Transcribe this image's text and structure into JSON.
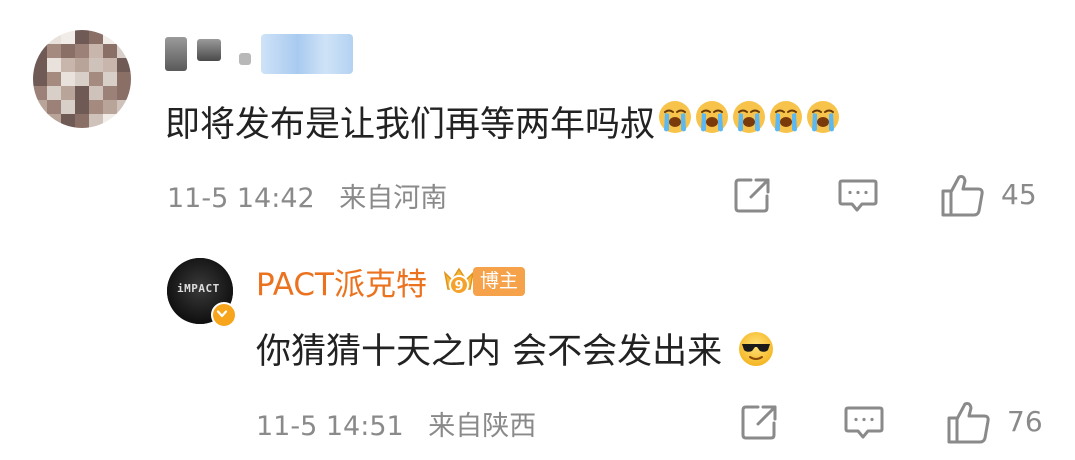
{
  "comment": {
    "text": "即将发布是让我们再等两年吗叔",
    "emoji_count": 5,
    "emoji_name": "crying-face-icon",
    "time": "11-5 14:42",
    "location": "来自河南",
    "like_count": "45",
    "name_color": "#222222"
  },
  "reply": {
    "author": "PACT派克特",
    "author_color": "#eb7320",
    "vip_level": "9",
    "badge_label": "博主",
    "avatar_text": "iMPACT",
    "text": "你猜猜十天之内 会不会发出来",
    "emoji_name": "sunglasses-face-icon",
    "time": "11-5 14:51",
    "location": "来自陕西",
    "like_count": "76"
  },
  "colors": {
    "meta_gray": "#8a8a8a",
    "accent_orange": "#eb7320",
    "badge_orange": "#f6a24b"
  }
}
